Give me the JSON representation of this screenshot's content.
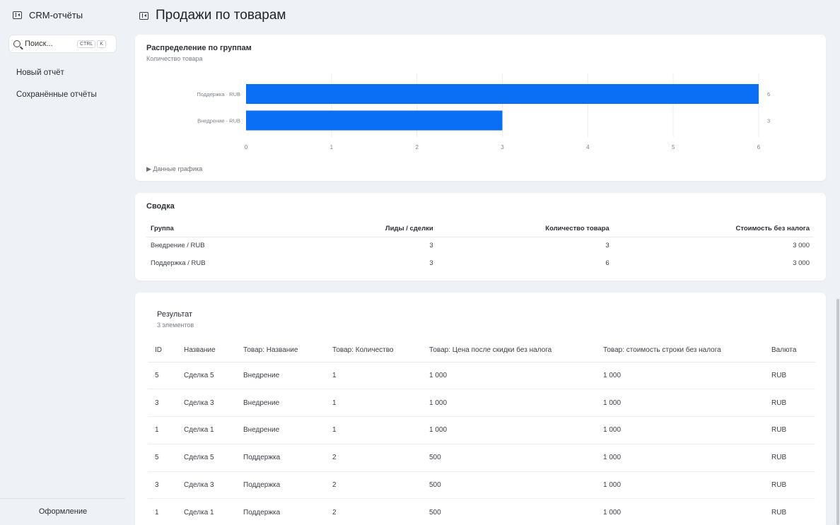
{
  "sidebar": {
    "title": "CRM-отчёты",
    "search_placeholder": "Поиск...",
    "kbd_ctrl": "CTRL",
    "kbd_k": "K",
    "nav": [
      "Новый отчёт",
      "Сохранённые отчёты"
    ],
    "footer": "Оформление"
  },
  "page": {
    "title": "Продажи по товарам"
  },
  "chart_card": {
    "title": "Распределение по группам",
    "subtitle": "Количество товара",
    "toggle": "Данные графика"
  },
  "chart_data": {
    "type": "bar",
    "orientation": "horizontal",
    "categories": [
      "Поддержка · RUB",
      "Внедрение · RUB"
    ],
    "values": [
      6,
      3
    ],
    "xlim": [
      0,
      6
    ],
    "xticks": [
      0,
      1,
      2,
      3,
      4,
      5,
      6
    ],
    "color": "#0a6ff5",
    "grid": true
  },
  "summary": {
    "title": "Сводка",
    "headers": [
      "Группа",
      "Лиды / сделки",
      "Количество товара",
      "Стоимость без налога"
    ],
    "rows": [
      [
        "Внедрение / RUB",
        "3",
        "3",
        "3 000"
      ],
      [
        "Поддержка / RUB",
        "3",
        "6",
        "3 000"
      ]
    ]
  },
  "result": {
    "title": "Результат",
    "subtitle": "3 элементов",
    "headers": [
      "ID",
      "Название",
      "Товар: Название",
      "Товар: Количество",
      "Товар: Цена после скидки без налога",
      "Товар: стоимость строки без налога",
      "Валюта"
    ],
    "rows": [
      [
        "5",
        "Сделка 5",
        "Внедрение",
        "1",
        "1 000",
        "1 000",
        "RUB"
      ],
      [
        "3",
        "Сделка 3",
        "Внедрение",
        "1",
        "1 000",
        "1 000",
        "RUB"
      ],
      [
        "1",
        "Сделка 1",
        "Внедрение",
        "1",
        "1 000",
        "1 000",
        "RUB"
      ],
      [
        "5",
        "Сделка 5",
        "Поддержка",
        "2",
        "500",
        "1 000",
        "RUB"
      ],
      [
        "3",
        "Сделка 3",
        "Поддержка",
        "2",
        "500",
        "1 000",
        "RUB"
      ],
      [
        "1",
        "Сделка 1",
        "Поддержка",
        "2",
        "500",
        "1 000",
        "RUB"
      ]
    ]
  }
}
